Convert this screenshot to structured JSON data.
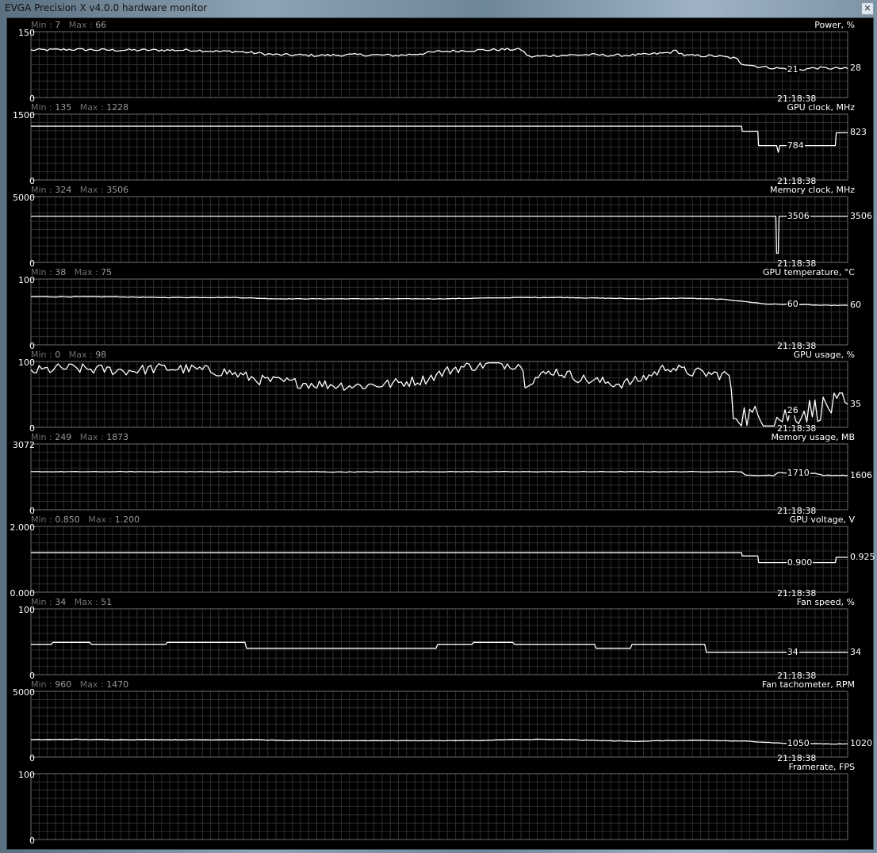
{
  "window": {
    "title": "EVGA Precision X v4.0.0 hardware monitor",
    "close_glyph": "✕"
  },
  "timestamp": "21:18:38",
  "colors": {
    "background": "#000000",
    "grid": "#2e2e2e",
    "trace": "#ffffff",
    "frame": "#6e6e6e"
  },
  "graphs": [
    {
      "name": "Power, %",
      "min_label": "Min :",
      "min": "7",
      "max_label": "Max :",
      "max": "66",
      "y_max": "150",
      "y_min": "0",
      "current": "28",
      "inline_value": "21",
      "has_time": true,
      "ymin": 0,
      "ymax": 150,
      "kind": "noisy",
      "trace_color": "#ffffff",
      "points": [
        [
          0,
          0.72
        ],
        [
          0.05,
          0.73
        ],
        [
          0.1,
          0.72
        ],
        [
          0.15,
          0.72
        ],
        [
          0.2,
          0.72
        ],
        [
          0.23,
          0.7
        ],
        [
          0.25,
          0.7
        ],
        [
          0.3,
          0.65
        ],
        [
          0.35,
          0.64
        ],
        [
          0.4,
          0.65
        ],
        [
          0.45,
          0.64
        ],
        [
          0.48,
          0.67
        ],
        [
          0.5,
          0.7
        ],
        [
          0.55,
          0.72
        ],
        [
          0.58,
          0.73
        ],
        [
          0.6,
          0.73
        ],
        [
          0.61,
          0.62
        ],
        [
          0.64,
          0.64
        ],
        [
          0.68,
          0.65
        ],
        [
          0.72,
          0.64
        ],
        [
          0.75,
          0.65
        ],
        [
          0.78,
          0.68
        ],
        [
          0.79,
          0.71
        ],
        [
          0.8,
          0.64
        ],
        [
          0.84,
          0.63
        ],
        [
          0.86,
          0.6
        ],
        [
          0.865,
          0.58
        ],
        [
          0.87,
          0.52
        ],
        [
          0.89,
          0.47
        ],
        [
          0.92,
          0.44
        ],
        [
          0.94,
          0.42
        ],
        [
          0.96,
          0.45
        ],
        [
          1,
          0.44
        ]
      ]
    },
    {
      "name": "GPU clock, MHz",
      "min_label": "Min :",
      "min": "135",
      "max_label": "Max :",
      "max": "1228",
      "y_max": "1500",
      "y_min": "0",
      "current": "823",
      "inline_value": "784",
      "has_time": true,
      "ymin": 0,
      "ymax": 1500,
      "kind": "step",
      "trace_color": "#ffffff",
      "points": [
        [
          0,
          0.818
        ],
        [
          0.87,
          0.818
        ],
        [
          0.871,
          0.74
        ],
        [
          0.89,
          0.74
        ],
        [
          0.891,
          0.523
        ],
        [
          0.913,
          0.523
        ],
        [
          0.915,
          0.42
        ],
        [
          0.917,
          0.523
        ],
        [
          0.935,
          0.523
        ],
        [
          0.937,
          0.523
        ],
        [
          0.985,
          0.523
        ],
        [
          0.986,
          0.717
        ],
        [
          1,
          0.717
        ]
      ]
    },
    {
      "name": "Memory clock, MHz",
      "min_label": "Min :",
      "min": "324",
      "max_label": "Max :",
      "max": "3506",
      "y_max": "5000",
      "y_min": "0",
      "current": "3506",
      "inline_value": "3506",
      "has_time": true,
      "ymin": 0,
      "ymax": 5000,
      "kind": "step",
      "trace_color": "#ffffff",
      "points": [
        [
          0,
          0.7
        ],
        [
          0.912,
          0.7
        ],
        [
          0.913,
          0.14
        ],
        [
          0.915,
          0.14
        ],
        [
          0.916,
          0.7
        ],
        [
          1,
          0.7
        ]
      ]
    },
    {
      "name": "GPU temperature, °C",
      "min_label": "Min :",
      "min": "38",
      "max_label": "Max :",
      "max": "75",
      "y_max": "100",
      "y_min": "0",
      "current": "60",
      "inline_value": "60",
      "has_time": true,
      "ymin": 0,
      "ymax": 100,
      "kind": "smooth",
      "trace_color": "#ffffff",
      "points": [
        [
          0,
          0.73
        ],
        [
          0.1,
          0.73
        ],
        [
          0.15,
          0.72
        ],
        [
          0.25,
          0.72
        ],
        [
          0.3,
          0.7
        ],
        [
          0.4,
          0.7
        ],
        [
          0.5,
          0.7
        ],
        [
          0.55,
          0.71
        ],
        [
          0.6,
          0.72
        ],
        [
          0.65,
          0.72
        ],
        [
          0.7,
          0.71
        ],
        [
          0.75,
          0.7
        ],
        [
          0.8,
          0.71
        ],
        [
          0.85,
          0.69
        ],
        [
          0.88,
          0.65
        ],
        [
          0.9,
          0.62
        ],
        [
          0.95,
          0.61
        ],
        [
          0.97,
          0.6
        ],
        [
          1,
          0.6
        ]
      ]
    },
    {
      "name": "GPU usage, %",
      "min_label": "Min :",
      "min": "0",
      "max_label": "Max :",
      "max": "98",
      "y_max": "100",
      "y_min": "0",
      "current": "35",
      "inline_value": "26",
      "has_time": true,
      "ymin": 0,
      "ymax": 100,
      "kind": "veryNoisy",
      "trace_color": "#ffffff",
      "points": [
        [
          0,
          0.85
        ],
        [
          0.04,
          0.9
        ],
        [
          0.08,
          0.88
        ],
        [
          0.12,
          0.86
        ],
        [
          0.16,
          0.9
        ],
        [
          0.2,
          0.88
        ],
        [
          0.24,
          0.84
        ],
        [
          0.28,
          0.72
        ],
        [
          0.32,
          0.68
        ],
        [
          0.36,
          0.65
        ],
        [
          0.4,
          0.63
        ],
        [
          0.44,
          0.66
        ],
        [
          0.48,
          0.72
        ],
        [
          0.52,
          0.9
        ],
        [
          0.56,
          0.96
        ],
        [
          0.6,
          0.96
        ],
        [
          0.605,
          0.68
        ],
        [
          0.64,
          0.86
        ],
        [
          0.68,
          0.72
        ],
        [
          0.72,
          0.66
        ],
        [
          0.74,
          0.7
        ],
        [
          0.76,
          0.8
        ],
        [
          0.78,
          0.93
        ],
        [
          0.8,
          0.85
        ],
        [
          0.84,
          0.8
        ],
        [
          0.855,
          0.8
        ],
        [
          0.86,
          0.22
        ],
        [
          0.9,
          0.12
        ],
        [
          0.92,
          0.15
        ],
        [
          0.93,
          0.2
        ],
        [
          0.95,
          0.25
        ],
        [
          0.97,
          0.3
        ],
        [
          1,
          0.35
        ]
      ]
    },
    {
      "name": "Memory usage, MB",
      "min_label": "Min :",
      "min": "249",
      "max_label": "Max :",
      "max": "1873",
      "y_max": "3072",
      "y_min": "0",
      "current": "1606",
      "inline_value": "1710",
      "has_time": true,
      "ymin": 0,
      "ymax": 3072,
      "kind": "smooth",
      "trace_color": "#ffffff",
      "points": [
        [
          0,
          0.578
        ],
        [
          0.35,
          0.578
        ],
        [
          0.36,
          0.574
        ],
        [
          0.5,
          0.578
        ],
        [
          0.6,
          0.578
        ],
        [
          0.87,
          0.578
        ],
        [
          0.875,
          0.523
        ],
        [
          0.91,
          0.523
        ],
        [
          0.915,
          0.565
        ],
        [
          0.925,
          0.56
        ],
        [
          0.96,
          0.555
        ],
        [
          0.97,
          0.523
        ],
        [
          1,
          0.523
        ]
      ]
    },
    {
      "name": "GPU voltage, V",
      "min_label": "Min :",
      "min": "0.850",
      "max_label": "Max :",
      "max": "1.200",
      "y_max": "2.000",
      "y_min": "0.000",
      "current": "0.925",
      "inline_value": "0.900",
      "has_time": true,
      "ymin": 0,
      "ymax": 2,
      "kind": "step",
      "trace_color": "#ffffff",
      "points": [
        [
          0,
          0.6
        ],
        [
          0.87,
          0.6
        ],
        [
          0.871,
          0.55
        ],
        [
          0.89,
          0.55
        ],
        [
          0.891,
          0.45
        ],
        [
          0.94,
          0.45
        ],
        [
          0.985,
          0.45
        ],
        [
          0.986,
          0.53
        ],
        [
          1,
          0.53
        ]
      ]
    },
    {
      "name": "Fan speed, %",
      "min_label": "Min :",
      "min": "34",
      "max_label": "Max :",
      "max": "51",
      "y_max": "100",
      "y_min": "0",
      "current": "34",
      "inline_value": "34",
      "has_time": true,
      "ymin": 0,
      "ymax": 100,
      "kind": "step",
      "trace_color": "#ffffff",
      "points": [
        [
          0,
          0.46
        ],
        [
          0.025,
          0.46
        ],
        [
          0.027,
          0.49
        ],
        [
          0.072,
          0.49
        ],
        [
          0.074,
          0.46
        ],
        [
          0.165,
          0.46
        ],
        [
          0.167,
          0.49
        ],
        [
          0.262,
          0.49
        ],
        [
          0.264,
          0.4
        ],
        [
          0.496,
          0.4
        ],
        [
          0.498,
          0.46
        ],
        [
          0.54,
          0.46
        ],
        [
          0.542,
          0.49
        ],
        [
          0.59,
          0.49
        ],
        [
          0.592,
          0.46
        ],
        [
          0.69,
          0.46
        ],
        [
          0.692,
          0.4
        ],
        [
          0.734,
          0.4
        ],
        [
          0.736,
          0.46
        ],
        [
          0.825,
          0.46
        ],
        [
          0.827,
          0.34
        ],
        [
          1,
          0.34
        ]
      ]
    },
    {
      "name": "Fan tachometer, RPM",
      "min_label": "Min :",
      "min": "960",
      "max_label": "Max :",
      "max": "1470",
      "y_max": "5000",
      "y_min": "0",
      "current": "1020",
      "inline_value": "1050",
      "has_time": true,
      "ymin": 0,
      "ymax": 5000,
      "kind": "smooth",
      "trace_color": "#ffffff",
      "points": [
        [
          0,
          0.265
        ],
        [
          0.05,
          0.27
        ],
        [
          0.1,
          0.265
        ],
        [
          0.15,
          0.265
        ],
        [
          0.2,
          0.263
        ],
        [
          0.25,
          0.265
        ],
        [
          0.28,
          0.265
        ],
        [
          0.3,
          0.255
        ],
        [
          0.35,
          0.25
        ],
        [
          0.45,
          0.25
        ],
        [
          0.5,
          0.25
        ],
        [
          0.55,
          0.252
        ],
        [
          0.58,
          0.265
        ],
        [
          0.62,
          0.27
        ],
        [
          0.66,
          0.265
        ],
        [
          0.7,
          0.25
        ],
        [
          0.74,
          0.24
        ],
        [
          0.78,
          0.25
        ],
        [
          0.82,
          0.255
        ],
        [
          0.86,
          0.245
        ],
        [
          0.88,
          0.24
        ],
        [
          0.92,
          0.21
        ],
        [
          0.96,
          0.205
        ],
        [
          0.98,
          0.2
        ],
        [
          1,
          0.2
        ]
      ]
    },
    {
      "name": "Framerate, FPS",
      "min_label": "",
      "min": "",
      "max_label": "",
      "max": "",
      "y_max": "100",
      "y_min": "0",
      "current": "",
      "inline_value": "",
      "has_time": false,
      "ymin": 0,
      "ymax": 100,
      "kind": "none",
      "trace_color": "#ffffff",
      "points": []
    }
  ]
}
